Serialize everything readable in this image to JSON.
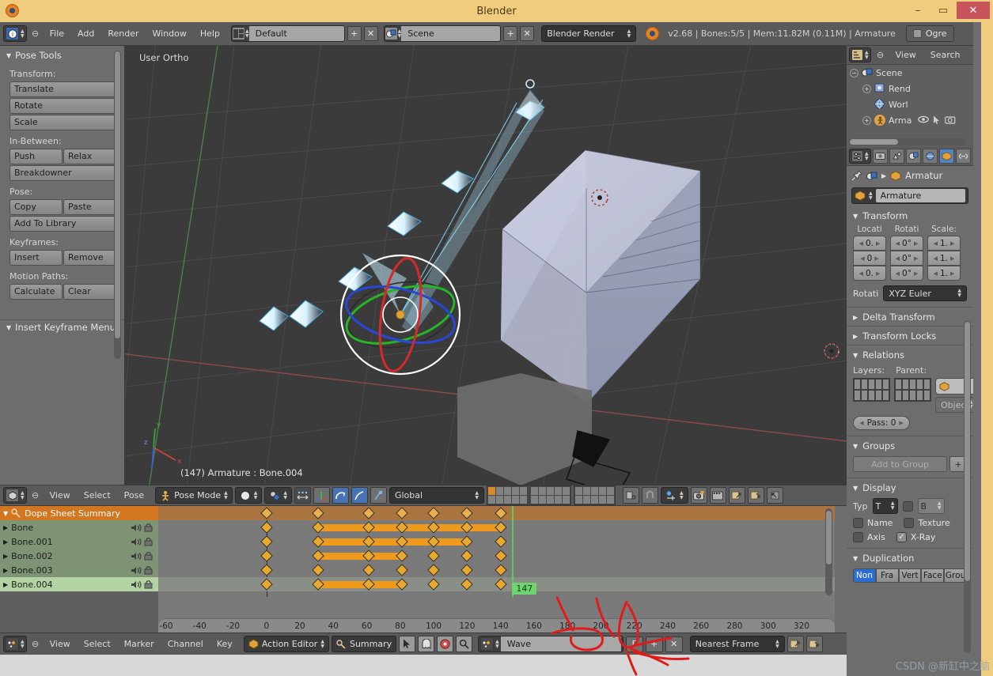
{
  "window": {
    "title": "Blender",
    "minimize": "–",
    "maximize": "▭",
    "close": "✕"
  },
  "infobar": {
    "editor_icon": "info-editor-icon",
    "collapse_icon": "⊖",
    "menus": [
      "File",
      "Add",
      "Render",
      "Window",
      "Help"
    ],
    "screen_layout": "Default",
    "add_btn": "+",
    "del_btn": "✕",
    "scene_name": "Scene",
    "scene_add_btn": "+",
    "scene_del_btn": "✕",
    "render_engine": "Blender Render",
    "status": "v2.68 | Bones:5/5  | Mem:11.82M (0.11M) | Armature",
    "ogre_label": "Ogre"
  },
  "tool_panel": {
    "header": "Pose Tools",
    "groups": [
      {
        "label": "Transform:",
        "rows": [
          [
            "Translate"
          ],
          [
            "Rotate"
          ],
          [
            "Scale"
          ]
        ]
      },
      {
        "label": "In-Between:",
        "rows": [
          [
            "Push",
            "Relax"
          ],
          [
            "Breakdowner"
          ]
        ]
      },
      {
        "label": "Pose:",
        "rows": [
          [
            "Copy",
            "Paste"
          ],
          [
            "Add To Library"
          ]
        ]
      },
      {
        "label": "Keyframes:",
        "rows": [
          [
            "Insert",
            "Remove"
          ]
        ]
      },
      {
        "label": "Motion Paths:",
        "rows": [
          [
            "Calculate",
            "Clear"
          ]
        ]
      }
    ],
    "footer_panel": "Insert Keyframe Menu"
  },
  "viewport": {
    "view_label": "User Ortho",
    "active_label": "(147) Armature : Bone.004"
  },
  "viewport_header": {
    "editor_icon": "3d-view-editor-icon",
    "collapse_icon": "⊖",
    "menus": [
      "View",
      "Select",
      "Pose"
    ],
    "mode": "Pose Mode",
    "shading": "solid-shading-icon",
    "pivot": "pivot-median-icon",
    "manipulator_translate": "manipulator-translate-icon",
    "manipulator_rotate": "manipulator-rotate-icon",
    "manipulator_scale": "manipulator-scale-icon",
    "orientation": "Global",
    "snap_icon": "magnet-icon",
    "proportional_icon": "proportional-edit-icon"
  },
  "dope_sheet": {
    "channels": [
      {
        "name": "Dope Sheet Summary",
        "type": "summary"
      },
      {
        "name": "Bone",
        "type": "normal"
      },
      {
        "name": "Bone.001",
        "type": "normal"
      },
      {
        "name": "Bone.002",
        "type": "normal"
      },
      {
        "name": "Bone.003",
        "type": "normal"
      },
      {
        "name": "Bone.004",
        "type": "selected"
      }
    ],
    "current_frame": "147",
    "ruler_ticks": [
      "-60",
      "-40",
      "-20",
      "0",
      "20",
      "40",
      "60",
      "80",
      "100",
      "120",
      "140",
      "160",
      "180",
      "200",
      "220",
      "240",
      "260",
      "280",
      "300",
      "320"
    ],
    "keyframes": {
      "summary": [
        0,
        31,
        61,
        81,
        100,
        120,
        140
      ],
      "bone": [
        0,
        31,
        61,
        81,
        100,
        120,
        140
      ],
      "bone001": [
        0,
        31,
        61,
        81,
        100,
        120,
        140
      ],
      "bone002": [
        0,
        31,
        61,
        81,
        100,
        120,
        140
      ],
      "bone003": [
        0,
        31,
        61,
        81,
        100,
        120,
        140
      ],
      "bone004": [
        0,
        31,
        61,
        81,
        100,
        120,
        140
      ]
    },
    "holds": {
      "bone": [
        [
          31,
          140
        ]
      ],
      "bone001": [
        [
          31,
          120
        ]
      ],
      "bone002": [
        [
          31,
          81
        ]
      ],
      "bone003": [],
      "bone004": [
        [
          31,
          81
        ]
      ]
    }
  },
  "dope_footer": {
    "editor_icon": "dope-sheet-editor-icon",
    "collapse_icon": "⊖",
    "menus": [
      "View",
      "Select",
      "Marker",
      "Channel",
      "Key"
    ],
    "editor_mode": "Action Editor",
    "summary_toggle": "Summary",
    "cursor_icon": "cursor-icon",
    "ghost_icon": "onion-skin-icon",
    "filter_icon": "filter-icon",
    "search_icon": "search-icon",
    "action_name": "Wave",
    "fake_user_btn": "F",
    "new_action_btn": "+",
    "unlink_action_btn": "✕",
    "snap_mode": "Nearest Frame",
    "copy_icon": "copy-pose-icon",
    "paste_icon": "paste-pose-icon"
  },
  "outliner": {
    "menus": [
      "View",
      "Search"
    ],
    "collapse_icon": "⊖",
    "rows": [
      {
        "label": "Scene",
        "indent": 0,
        "expander": "−",
        "icon_color": "#c7cdd6"
      },
      {
        "label": "Rend",
        "indent": 1,
        "expander": "+",
        "icon_color": "#7f98c9"
      },
      {
        "label": "Worl",
        "indent": 1,
        "expander": "",
        "icon_color": "#6f9ad6"
      },
      {
        "label": "Arma",
        "indent": 1,
        "expander": "+",
        "icon_color": "#e2a24a"
      }
    ],
    "row_icons": [
      "eye-icon",
      "cursor-icon",
      "camera-icon"
    ]
  },
  "properties": {
    "breadcrumb_obj": "Armatur",
    "id_name": "Armature",
    "sections": [
      {
        "title": "Transform",
        "open": true
      },
      {
        "title": "Delta Transform",
        "open": false
      },
      {
        "title": "Transform Locks",
        "open": false
      },
      {
        "title": "Relations",
        "open": true
      },
      {
        "title": "Groups",
        "open": true
      },
      {
        "title": "Display",
        "open": true
      },
      {
        "title": "Duplication",
        "open": true
      }
    ],
    "transform": {
      "col_labels": [
        "Locati",
        "Rotati",
        "Scale:"
      ],
      "location": [
        "0.",
        "0",
        "0."
      ],
      "rotation": [
        "0°",
        "0°",
        "0°"
      ],
      "scale": [
        "1.",
        "1.",
        "1."
      ],
      "rotation_mode_label": "Rotati",
      "rotation_mode": "XYZ Euler"
    },
    "relations": {
      "layers_label": "Layers:",
      "parent_label": "Parent:",
      "parent_value": "",
      "parent_type": "Object",
      "pass_index": "Pass: 0"
    },
    "groups": {
      "add_to_group": "Add to Group",
      "add_btn": "+"
    },
    "display": {
      "type_label": "Typ",
      "type_value": "T",
      "bone_value": "B",
      "checks": [
        {
          "label": "Name",
          "checked": false
        },
        {
          "label": "Texture",
          "checked": false
        },
        {
          "label": "Axis",
          "checked": false
        },
        {
          "label": "X-Ray",
          "checked": true
        }
      ]
    },
    "duplication": {
      "options": [
        "Non",
        "Fra",
        "Vert",
        "Face",
        "Grou"
      ],
      "selected": "Non"
    }
  },
  "watermark": "CSDN @新缸中之脑",
  "colors": {
    "title_bar": "#f0cd7e",
    "accent_blue": "#5184c9",
    "keyframe": "#e8a92e",
    "hold_bar": "#f09a1c",
    "summary_row": "#d2761f",
    "selected_channel": "#b4d3a5",
    "current_frame": "#6ed46e",
    "annotation_red": "#e01b1b"
  }
}
